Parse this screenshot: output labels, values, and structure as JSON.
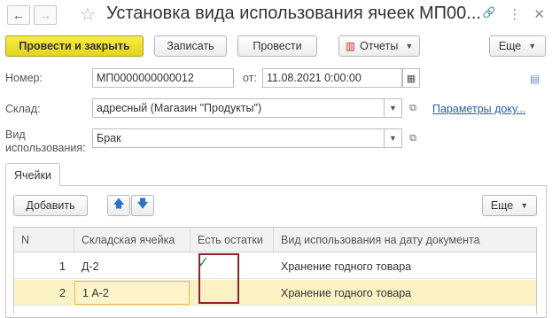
{
  "window": {
    "back_icon": "←",
    "forward_icon": "→",
    "favorite_icon": "☆",
    "title": "Установка вида использования ячеек МП00...",
    "link_icon": "🔗",
    "menu_icon": "⋮",
    "close_icon": "✕"
  },
  "toolbar": {
    "post_close": "Провести и закрыть",
    "save": "Записать",
    "post": "Провести",
    "reports": "Отчеты",
    "more": "Еще"
  },
  "form": {
    "number_label": "Номер:",
    "number_value": "МП0000000000012",
    "date_label": "от:",
    "date_value": "11.08.2021  0:00:00",
    "warehouse_label": "Склад:",
    "warehouse_value": "адресный (Магазин \"Продукты\")",
    "warehouse_params_link": "Параметры доку...",
    "usage_label_line1": "Вид",
    "usage_label_line2": "использования:",
    "usage_value": "Брак"
  },
  "tabs": {
    "cells": "Ячейки"
  },
  "cells_toolbar": {
    "add": "Добавить",
    "more": "Еще"
  },
  "table": {
    "headers": {
      "n": "N",
      "cell": "Складская ячейка",
      "has_stock": "Есть остатки",
      "usage_on_date": "Вид использования на дату документа"
    },
    "rows": [
      {
        "n": "1",
        "cell": "Д-2",
        "has_stock": "✓",
        "usage": "Хранение годного товара"
      },
      {
        "n": "2",
        "cell": "1 А-2",
        "has_stock": "",
        "usage": "Хранение годного товара"
      }
    ]
  }
}
